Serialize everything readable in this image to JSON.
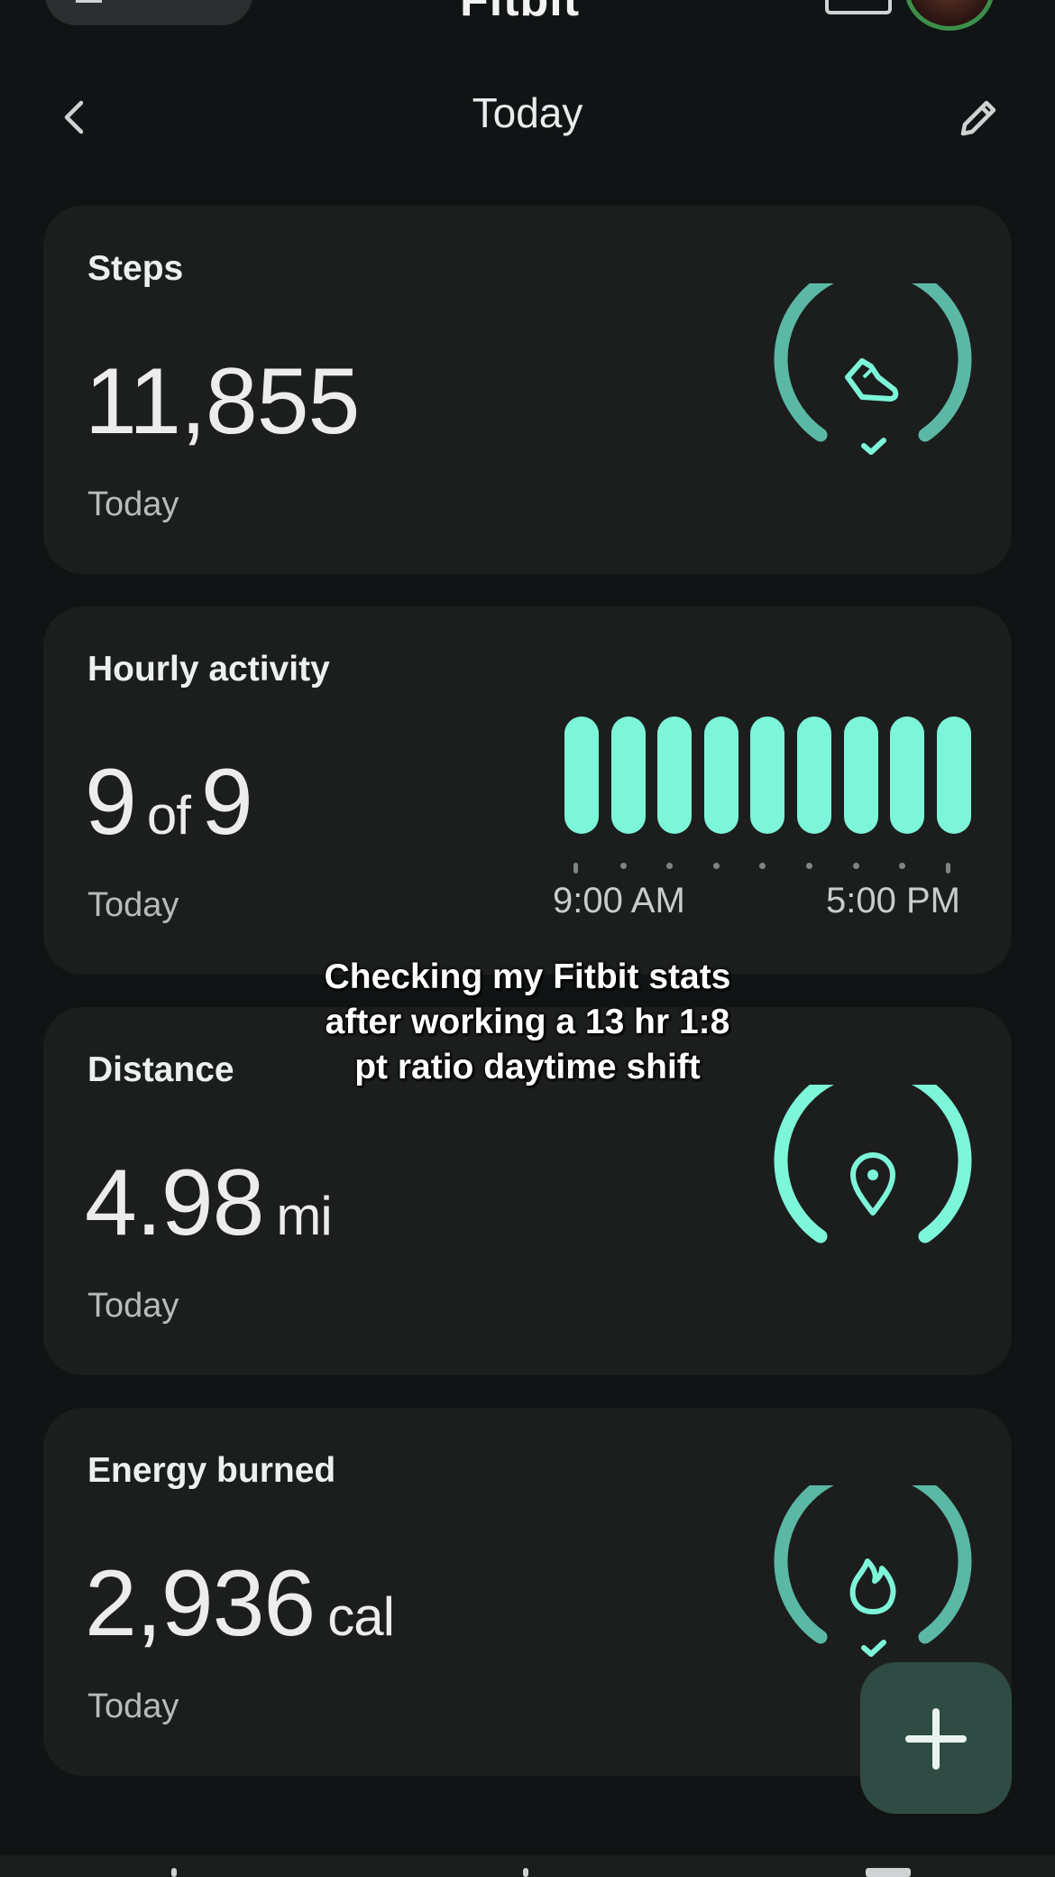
{
  "app": {
    "brand": "Fitbit"
  },
  "header": {
    "title": "Today"
  },
  "cards": {
    "steps": {
      "title": "Steps",
      "value": "11,855",
      "sub": "Today",
      "goal_met": true,
      "progress": 1.0
    },
    "hourly": {
      "title": "Hourly activity",
      "value": "9",
      "of": "of",
      "total": "9",
      "sub": "Today",
      "time_start": "9:00 AM",
      "time_end": "5:00 PM",
      "hours_active": [
        1,
        1,
        1,
        1,
        1,
        1,
        1,
        1,
        1
      ]
    },
    "distance": {
      "title": "Distance",
      "value": "4.98",
      "unit": "mi",
      "sub": "Today",
      "progress": 1.0
    },
    "energy": {
      "title": "Energy burned",
      "value": "2,936",
      "unit": "cal",
      "sub": "Today",
      "goal_met": true,
      "progress": 1.0
    }
  },
  "overlay_caption": {
    "line1": "Checking my Fitbit stats",
    "line2": "after working a 13 hr 1:8",
    "line3": "pt ratio daytime shift"
  },
  "colors": {
    "accent": "#7df5d8",
    "accent_muted": "#5bb8a4",
    "card_bg": "#1c1e1e",
    "page_bg": "#111414"
  },
  "icons": {
    "back": "chevron-left-icon",
    "edit": "pencil-icon",
    "steps": "shoe-icon",
    "distance": "location-pin-icon",
    "energy": "flame-icon",
    "add": "plus-icon"
  }
}
